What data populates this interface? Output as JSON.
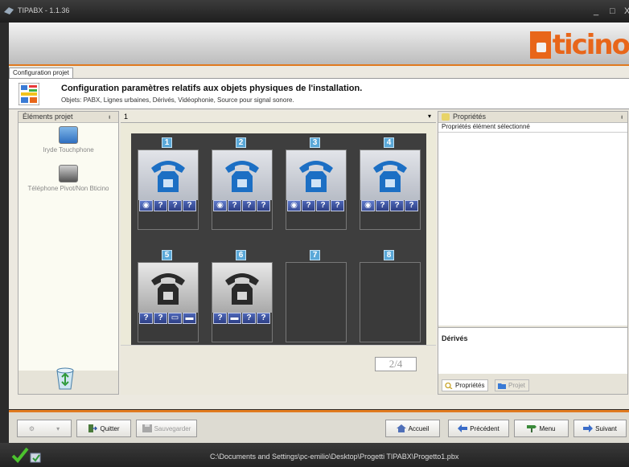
{
  "window": {
    "title": "TIPABX - 1.1.36",
    "minimize": "_",
    "maximize": "□",
    "close": "X"
  },
  "brand": {
    "logo_text": "ticino"
  },
  "tabs": [
    {
      "label": "Configuration projet"
    }
  ],
  "info": {
    "heading": "Configuration paramètres relatifs aux objets physiques de l'installation.",
    "subheading": "Objets: PABX, Lignes urbaines, Dérivés, Vidéophonie, Source pour signal sonore."
  },
  "left_panel": {
    "title": "Éléments projet",
    "pin": "ᵼ",
    "items": [
      {
        "label": "Iryde Touchphone",
        "icon": "blue-phone-icon"
      },
      {
        "label": "Téléphone Pivot/Non Bticino",
        "icon": "black-phone-icon"
      }
    ],
    "trash_icon": "recycle-bin-icon"
  },
  "center": {
    "selector_value": "1",
    "selector_arrow": "▾",
    "pager": "2/4",
    "cells": [
      {
        "number": "1",
        "phone": "blue",
        "buttons": [
          "eye",
          "?",
          "?",
          "?"
        ]
      },
      {
        "number": "2",
        "phone": "blue",
        "buttons": [
          "eye",
          "?",
          "?",
          "?"
        ]
      },
      {
        "number": "3",
        "phone": "blue",
        "buttons": [
          "eye",
          "?",
          "?",
          "?"
        ]
      },
      {
        "number": "4",
        "phone": "blue",
        "buttons": [
          "eye",
          "?",
          "?",
          "?"
        ]
      },
      {
        "number": "5",
        "phone": "black",
        "buttons": [
          "?",
          "?",
          "box",
          "card"
        ]
      },
      {
        "number": "6",
        "phone": "black",
        "buttons": [
          "?",
          "bar",
          "?",
          "?"
        ]
      },
      {
        "number": "7",
        "phone": "",
        "buttons": []
      },
      {
        "number": "8",
        "phone": "",
        "buttons": []
      }
    ]
  },
  "right_panel": {
    "title": "Propriétés",
    "pin": "ᵼ",
    "subtitle": "Propriétés élément sélectionné",
    "section_title": "Dérivés",
    "tabs": [
      {
        "label": "Propriétés",
        "active": true
      },
      {
        "label": "Projet",
        "active": false
      }
    ]
  },
  "toolbar": {
    "quit": "Quitter",
    "save": "Sauvegarder",
    "home": "Accueil",
    "previous": "Précédent",
    "menu": "Menu",
    "next": "Suivant"
  },
  "status": {
    "path": "C:\\Documents and Settings\\pc-emilio\\Desktop\\Progetti TIPABX\\Progetto1.pbx"
  },
  "colors": {
    "accent": "#e07a1f",
    "brand": "#e8661a",
    "cell_number": "#5aa8d8",
    "button_blue": "#2d3f86"
  }
}
